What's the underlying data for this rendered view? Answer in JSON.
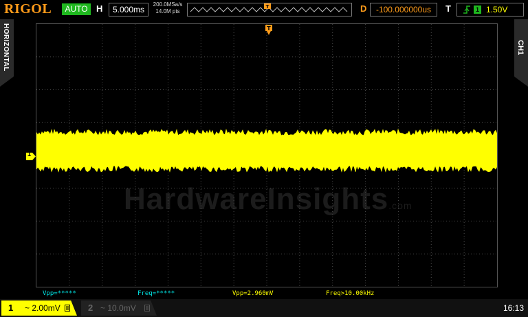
{
  "top": {
    "logo": "RIGOL",
    "mode": "AUTO",
    "h_label": "H",
    "timebase": "5.000ms",
    "sample_rate": "200.0MSa/s",
    "mem_depth": "14.0M pts",
    "d_label": "D",
    "delay": "-100.000000us",
    "t_label": "T",
    "trigger_source": "1",
    "trigger_level": "1.50V"
  },
  "side": {
    "left_tab": "HORIZONTAL",
    "right_tab": "CH1"
  },
  "marker": {
    "ch1": "1"
  },
  "watermark": {
    "main": "HardwareInsights",
    "suffix": ".com"
  },
  "measurements": [
    {
      "text": "Vpp=*****",
      "color": "#00e5e5"
    },
    {
      "text": "Freq=*****",
      "color": "#00e5e5"
    },
    {
      "text": "Vpp=2.960mV",
      "color": "#ffff00"
    },
    {
      "text": "Freq>10.00kHz",
      "color": "#ffff00"
    }
  ],
  "bottom": {
    "ch1_number": "1",
    "ch1_scale": "~ 2.00mV",
    "ch2_number": "2",
    "ch2_scale": "~ 10.0mV",
    "time": "16:13"
  },
  "colors": {
    "ch1": "#ffff00",
    "accent": "#ff9c1a",
    "auto": "#1fb81f",
    "grid": "#555555"
  }
}
